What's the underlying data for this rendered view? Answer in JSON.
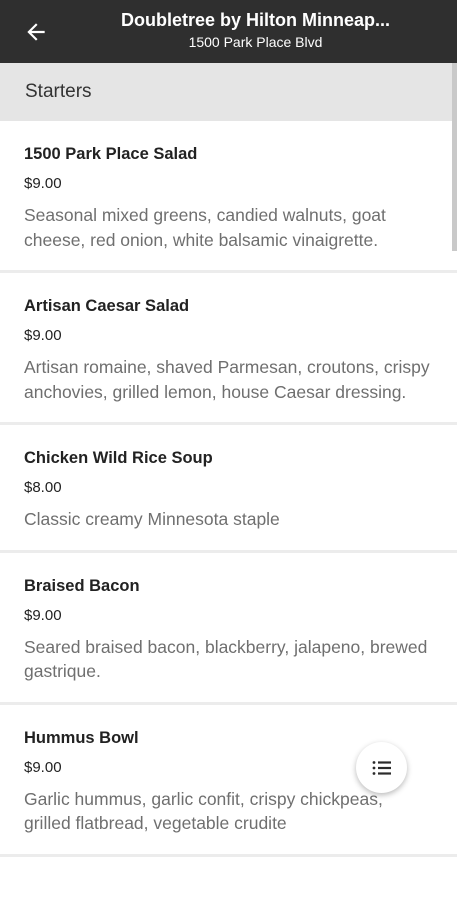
{
  "header": {
    "title": "Doubletree by Hilton Minneap...",
    "subtitle": "1500 Park Place Blvd"
  },
  "section": {
    "title": "Starters"
  },
  "items": [
    {
      "name": "1500 Park Place Salad",
      "price": "$9.00",
      "description": "Seasonal mixed greens, candied walnuts, goat cheese, red onion, white balsamic vinaigrette."
    },
    {
      "name": "Artisan Caesar Salad",
      "price": "$9.00",
      "description": "Artisan romaine, shaved Parmesan, croutons, crispy anchovies, grilled lemon, house Caesar dressing."
    },
    {
      "name": "Chicken Wild Rice Soup",
      "price": "$8.00",
      "description": "Classic creamy Minnesota staple"
    },
    {
      "name": "Braised Bacon",
      "price": "$9.00",
      "description": "Seared braised bacon, blackberry, jalapeno, brewed gastrique."
    },
    {
      "name": "Hummus Bowl",
      "price": "$9.00",
      "description": "Garlic hummus, garlic confit, crispy chickpeas, grilled flatbread, vegetable crudite"
    }
  ],
  "icons": {
    "back": "arrow-left-icon",
    "menu_list": "list-icon"
  }
}
